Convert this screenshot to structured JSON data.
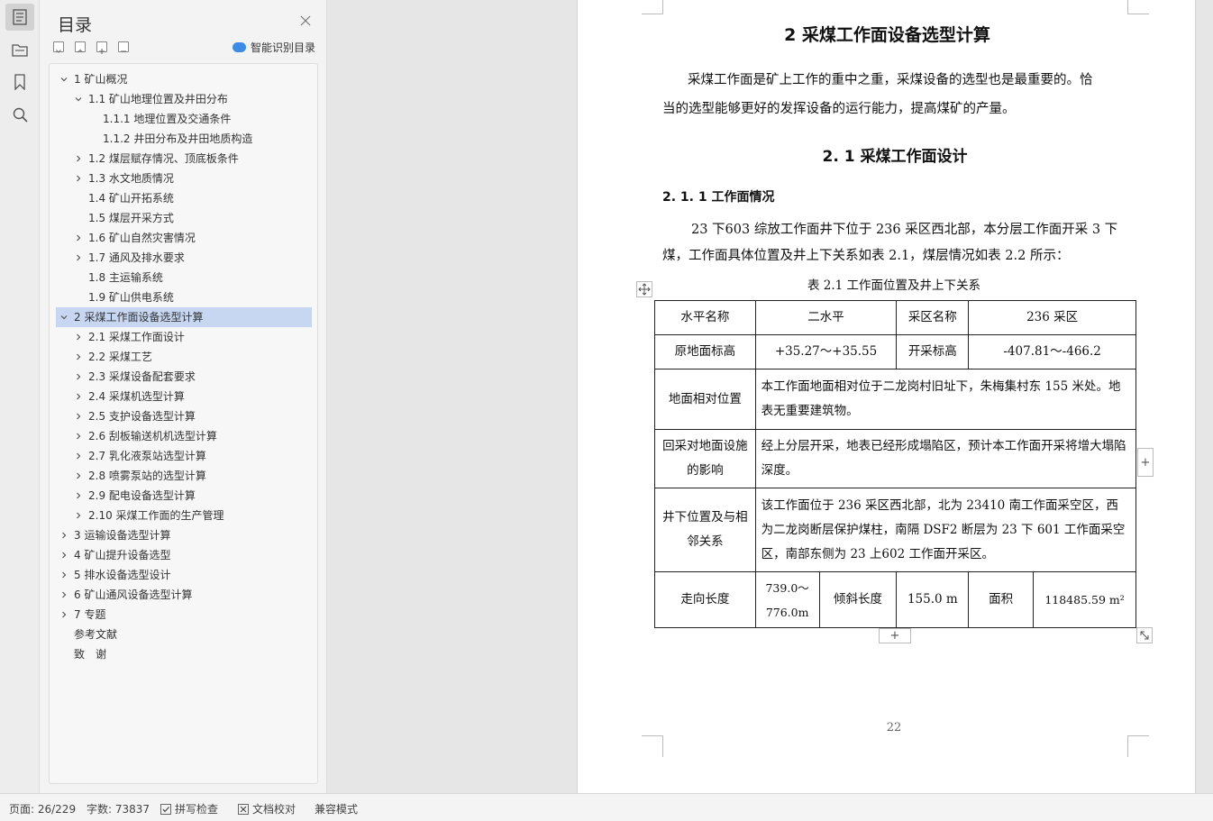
{
  "nav": {
    "title": "目录",
    "smart_toc": "智能识别目录",
    "items": [
      {
        "label": "1 矿山概况",
        "level": 0,
        "arrow": "down"
      },
      {
        "label": "1.1 矿山地理位置及井田分布",
        "level": 1,
        "arrow": "down"
      },
      {
        "label": "1.1.1 地理位置及交通条件",
        "level": 2,
        "arrow": "none"
      },
      {
        "label": "1.1.2 井田分布及井田地质构造",
        "level": 2,
        "arrow": "none"
      },
      {
        "label": "1.2 煤层赋存情况、顶底板条件",
        "level": 1,
        "arrow": "right"
      },
      {
        "label": "1.3 水文地质情况",
        "level": 1,
        "arrow": "right"
      },
      {
        "label": "1.4 矿山开拓系统",
        "level": 1,
        "arrow": "none"
      },
      {
        "label": "1.5 煤层开采方式",
        "level": 1,
        "arrow": "none"
      },
      {
        "label": "1.6 矿山自然灾害情况",
        "level": 1,
        "arrow": "right"
      },
      {
        "label": "1.7 通风及排水要求",
        "level": 1,
        "arrow": "right"
      },
      {
        "label": "1.8 主运输系统",
        "level": 1,
        "arrow": "none"
      },
      {
        "label": "1.9 矿山供电系统",
        "level": 1,
        "arrow": "none"
      },
      {
        "label": "2 采煤工作面设备选型计算",
        "level": 0,
        "arrow": "down",
        "selected": true
      },
      {
        "label": "2.1 采煤工作面设计",
        "level": 1,
        "arrow": "right"
      },
      {
        "label": "2.2 采煤工艺",
        "level": 1,
        "arrow": "right"
      },
      {
        "label": "2.3 采煤设备配套要求",
        "level": 1,
        "arrow": "right"
      },
      {
        "label": "2.4 采煤机选型计算",
        "level": 1,
        "arrow": "right"
      },
      {
        "label": "2.5 支护设备选型计算",
        "level": 1,
        "arrow": "right"
      },
      {
        "label": "2.6 刮板输送机机选型计算",
        "level": 1,
        "arrow": "right"
      },
      {
        "label": "2.7 乳化液泵站选型计算",
        "level": 1,
        "arrow": "right"
      },
      {
        "label": "2.8 喷雾泵站的选型计算",
        "level": 1,
        "arrow": "right"
      },
      {
        "label": "2.9 配电设备选型计算",
        "level": 1,
        "arrow": "right"
      },
      {
        "label": "2.10 采煤工作面的生产管理",
        "level": 1,
        "arrow": "right"
      },
      {
        "label": "3 运输设备选型计算",
        "level": 0,
        "arrow": "right"
      },
      {
        "label": "4 矿山提升设备选型",
        "level": 0,
        "arrow": "right"
      },
      {
        "label": "5 排水设备选型设计",
        "level": 0,
        "arrow": "right"
      },
      {
        "label": "6 矿山通风设备选型计算",
        "level": 0,
        "arrow": "right"
      },
      {
        "label": "7 专题",
        "level": 0,
        "arrow": "right"
      },
      {
        "label": "参考文献",
        "level": 0,
        "arrow": "none"
      },
      {
        "label": "致　谢",
        "level": 0,
        "arrow": "none"
      }
    ]
  },
  "doc": {
    "h1": "2 采煤工作面设备选型计算",
    "intro_line1": "采煤工作面是矿上工作的重中之重，采煤设备的选型也是最重要的。恰",
    "intro_line2": "当的选型能够更好的发挥设备的运行能力，提高煤矿的产量。",
    "h2": "2. 1 采煤工作面设计",
    "h3": "2. 1. 1 工作面情况",
    "p2_line1": "23 下603 综放工作面井下位于 236 采区西北部，本分层工作面开采 3 下",
    "p2_line2": "煤，工作面具体位置及井上下关系如表 2.1，煤层情况如表 2.2 所示：",
    "table_caption": "表 2.1 工作面位置及井上下关系",
    "table": {
      "r1": [
        "水平名称",
        "二水平",
        "采区名称",
        "236 采区"
      ],
      "r2": [
        "原地面标高",
        "+35.27～+35.55",
        "开采标高",
        "-407.81～-466.2"
      ],
      "r3_label": "地面相对位置",
      "r3_text": "本工作面地面相对位于二龙岗村旧址下，朱梅集村东 155 米处。地表无重要建筑物。",
      "r4_label": "回采对地面设施的影响",
      "r4_text": "经上分层开采，地表已经形成塌陷区，预计本工作面开采将增大塌陷深度。",
      "r5_label": "井下位置及与相邻关系",
      "r5_text": "该工作面位于 236 采区西北部，北为 23410 南工作面采空区，西为二龙岗断层保护煤柱，南隔 DSF2 断层为 23 下 601 工作面采空区，南部东侧为 23 上602 工作面开采区。",
      "r6": [
        "走向长度",
        "739.0～776.0m",
        "倾斜长度",
        "155.0 m",
        "面积",
        "118485.59 m²"
      ]
    },
    "page_number": "22"
  },
  "status": {
    "page": "页面: 26/229",
    "words": "字数: 73837",
    "spell": "拼写检查",
    "proof": "文档校对",
    "compat": "兼容模式"
  }
}
